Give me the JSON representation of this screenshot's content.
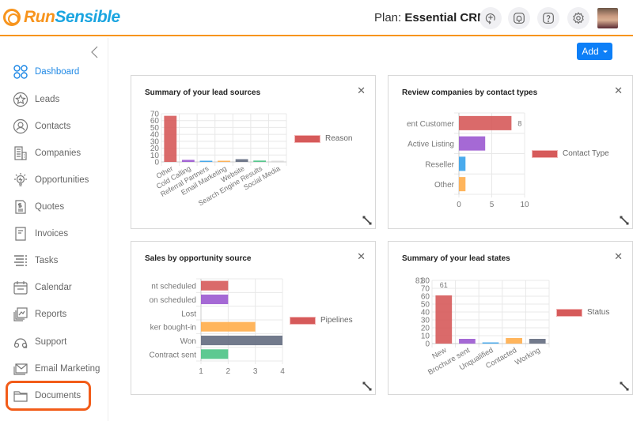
{
  "header": {
    "logo_part1": "Run",
    "logo_part2": "Sensible",
    "plan_label": "Plan:",
    "plan_name": "Essential CRM",
    "icons": [
      "add-reminder-icon",
      "notification-bell-icon",
      "help-icon",
      "settings-gear-icon"
    ]
  },
  "sidebar": {
    "items": [
      {
        "label": "Dashboard",
        "icon": "dashboard-icon",
        "active": true
      },
      {
        "label": "Leads",
        "icon": "leads-star-icon"
      },
      {
        "label": "Contacts",
        "icon": "contacts-icon"
      },
      {
        "label": "Companies",
        "icon": "companies-building-icon"
      },
      {
        "label": "Opportunities",
        "icon": "opportunities-bulb-icon"
      },
      {
        "label": "Quotes",
        "icon": "quotes-document-icon"
      },
      {
        "label": "Invoices",
        "icon": "invoices-icon"
      },
      {
        "label": "Tasks",
        "icon": "tasks-list-icon"
      },
      {
        "label": "Calendar",
        "icon": "calendar-icon"
      },
      {
        "label": "Reports",
        "icon": "reports-icon"
      },
      {
        "label": "Support",
        "icon": "support-headset-icon"
      },
      {
        "label": "Email Marketing",
        "icon": "email-icon"
      },
      {
        "label": "Documents",
        "icon": "folder-icon",
        "highlighted": true
      }
    ]
  },
  "toolbar": {
    "add_label": "Add"
  },
  "colors": {
    "accent": "#f7941d",
    "primary": "#0d7ff7",
    "highlight": "#f25c19",
    "series": [
      "#d65a5a",
      "#9b59d0",
      "#36a2eb",
      "#ffad4a",
      "#636b80",
      "#4bc385",
      "#d9d9d9"
    ]
  },
  "chart_data": [
    {
      "id": "lead-sources",
      "type": "bar",
      "title": "Summary of your lead sources",
      "categories": [
        "Other",
        "Cold Calling",
        "Referral Partners",
        "Email Marketing",
        "Website",
        "Search Engine Results",
        "Social Media"
      ],
      "series": [
        {
          "name": "Reason",
          "values": [
            67,
            3,
            1,
            1,
            4,
            2,
            1
          ]
        }
      ],
      "ylim": [
        0,
        70
      ],
      "yticks": [
        0,
        10,
        20,
        30,
        40,
        50,
        60,
        70
      ],
      "legend": "right",
      "grid": true
    },
    {
      "id": "contact-types",
      "type": "bar",
      "orientation": "horizontal",
      "title": "Review companies by contact types",
      "categories": [
        "ent Customer",
        "Active Listing",
        "Reseller",
        "Other"
      ],
      "series": [
        {
          "name": "Contact Type",
          "values": [
            8,
            4,
            1,
            1
          ]
        }
      ],
      "data_labels": [
        "8",
        "",
        "",
        ""
      ],
      "xlim": [
        0,
        10
      ],
      "xticks": [
        0,
        5,
        10
      ],
      "legend": "right",
      "grid": true
    },
    {
      "id": "opportunity-source",
      "type": "bar",
      "orientation": "horizontal",
      "title": "Sales by opportunity source",
      "categories": [
        "nt scheduled",
        "on scheduled",
        "Lost",
        "ker bought-in",
        "Won",
        "Contract sent"
      ],
      "series": [
        {
          "name": "Pipelines",
          "values": [
            2,
            2,
            1,
            3,
            4,
            2
          ]
        }
      ],
      "xlim": [
        1,
        4
      ],
      "xticks": [
        1,
        2,
        3,
        4
      ],
      "legend": "right",
      "grid": true
    },
    {
      "id": "lead-states",
      "type": "bar",
      "title": "Summary of your lead states",
      "categories": [
        "New",
        "Brochure sent",
        "Unqualified",
        "Contacted",
        "Working"
      ],
      "series": [
        {
          "name": "Status",
          "values": [
            61,
            6,
            1,
            7,
            6
          ]
        }
      ],
      "data_labels": [
        "61",
        "",
        "",
        "",
        ""
      ],
      "ylim": [
        0,
        80
      ],
      "yticks": [
        0,
        10,
        20,
        30,
        40,
        50,
        60,
        70,
        80
      ],
      "overlap_tick_label": "81",
      "legend": "right",
      "grid": true
    }
  ]
}
